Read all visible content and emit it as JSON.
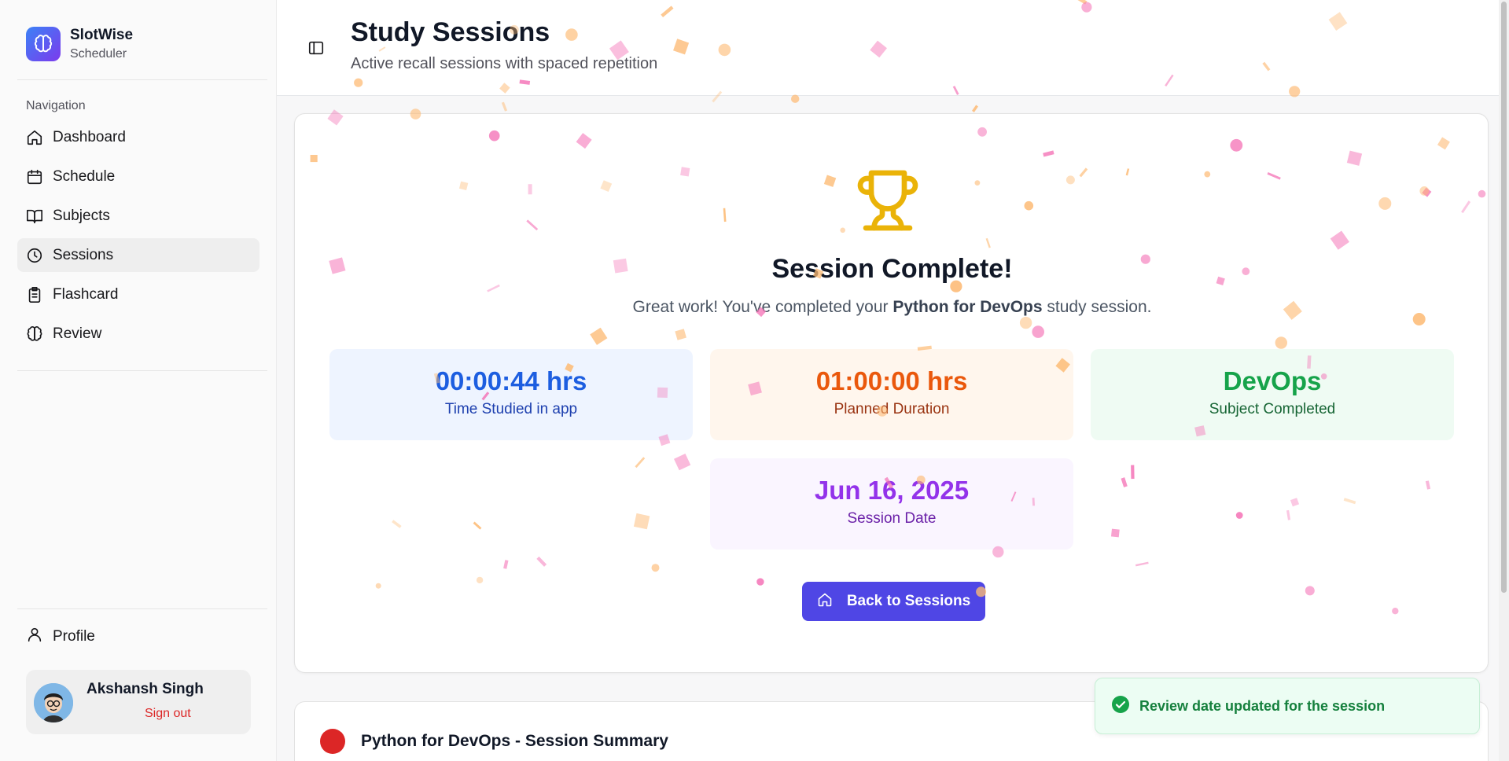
{
  "brand": {
    "name": "SlotWise",
    "subtitle": "Scheduler"
  },
  "nav": {
    "label": "Navigation",
    "items": [
      {
        "label": "Dashboard",
        "icon": "home-icon"
      },
      {
        "label": "Schedule",
        "icon": "calendar-icon"
      },
      {
        "label": "Subjects",
        "icon": "book-icon"
      },
      {
        "label": "Sessions",
        "icon": "clock-icon",
        "active": true
      },
      {
        "label": "Flashcard",
        "icon": "clipboard-icon"
      },
      {
        "label": "Review",
        "icon": "brain-icon"
      }
    ],
    "profile_label": "Profile"
  },
  "user": {
    "name": "Akshansh Singh",
    "signout_label": "Sign out"
  },
  "header": {
    "title": "Study Sessions",
    "subtitle": "Active recall sessions with spaced repetition"
  },
  "completion": {
    "title": "Session Complete!",
    "message_prefix": "Great work! You've completed your ",
    "subject_bold": "Python for DevOps",
    "message_suffix": " study session.",
    "stats": {
      "time_studied": {
        "value": "00:00:44 hrs",
        "caption": "Time Studied in app"
      },
      "planned": {
        "value": "01:00:00 hrs",
        "caption": "Planned Duration"
      },
      "subject": {
        "value": "DevOps",
        "caption": "Subject Completed"
      },
      "date": {
        "value": "Jun 16, 2025",
        "caption": "Session Date"
      }
    },
    "back_button_label": "Back to Sessions"
  },
  "summary": {
    "title": "Python for DevOps - Session Summary"
  },
  "toast": {
    "message": "Review date updated for the session"
  },
  "colors": {
    "primary": "#4f46e5",
    "trophy": "#eab308",
    "toast_green": "#16a34a",
    "confetti_pink": "#f472b6",
    "confetti_orange": "#fdba74"
  }
}
